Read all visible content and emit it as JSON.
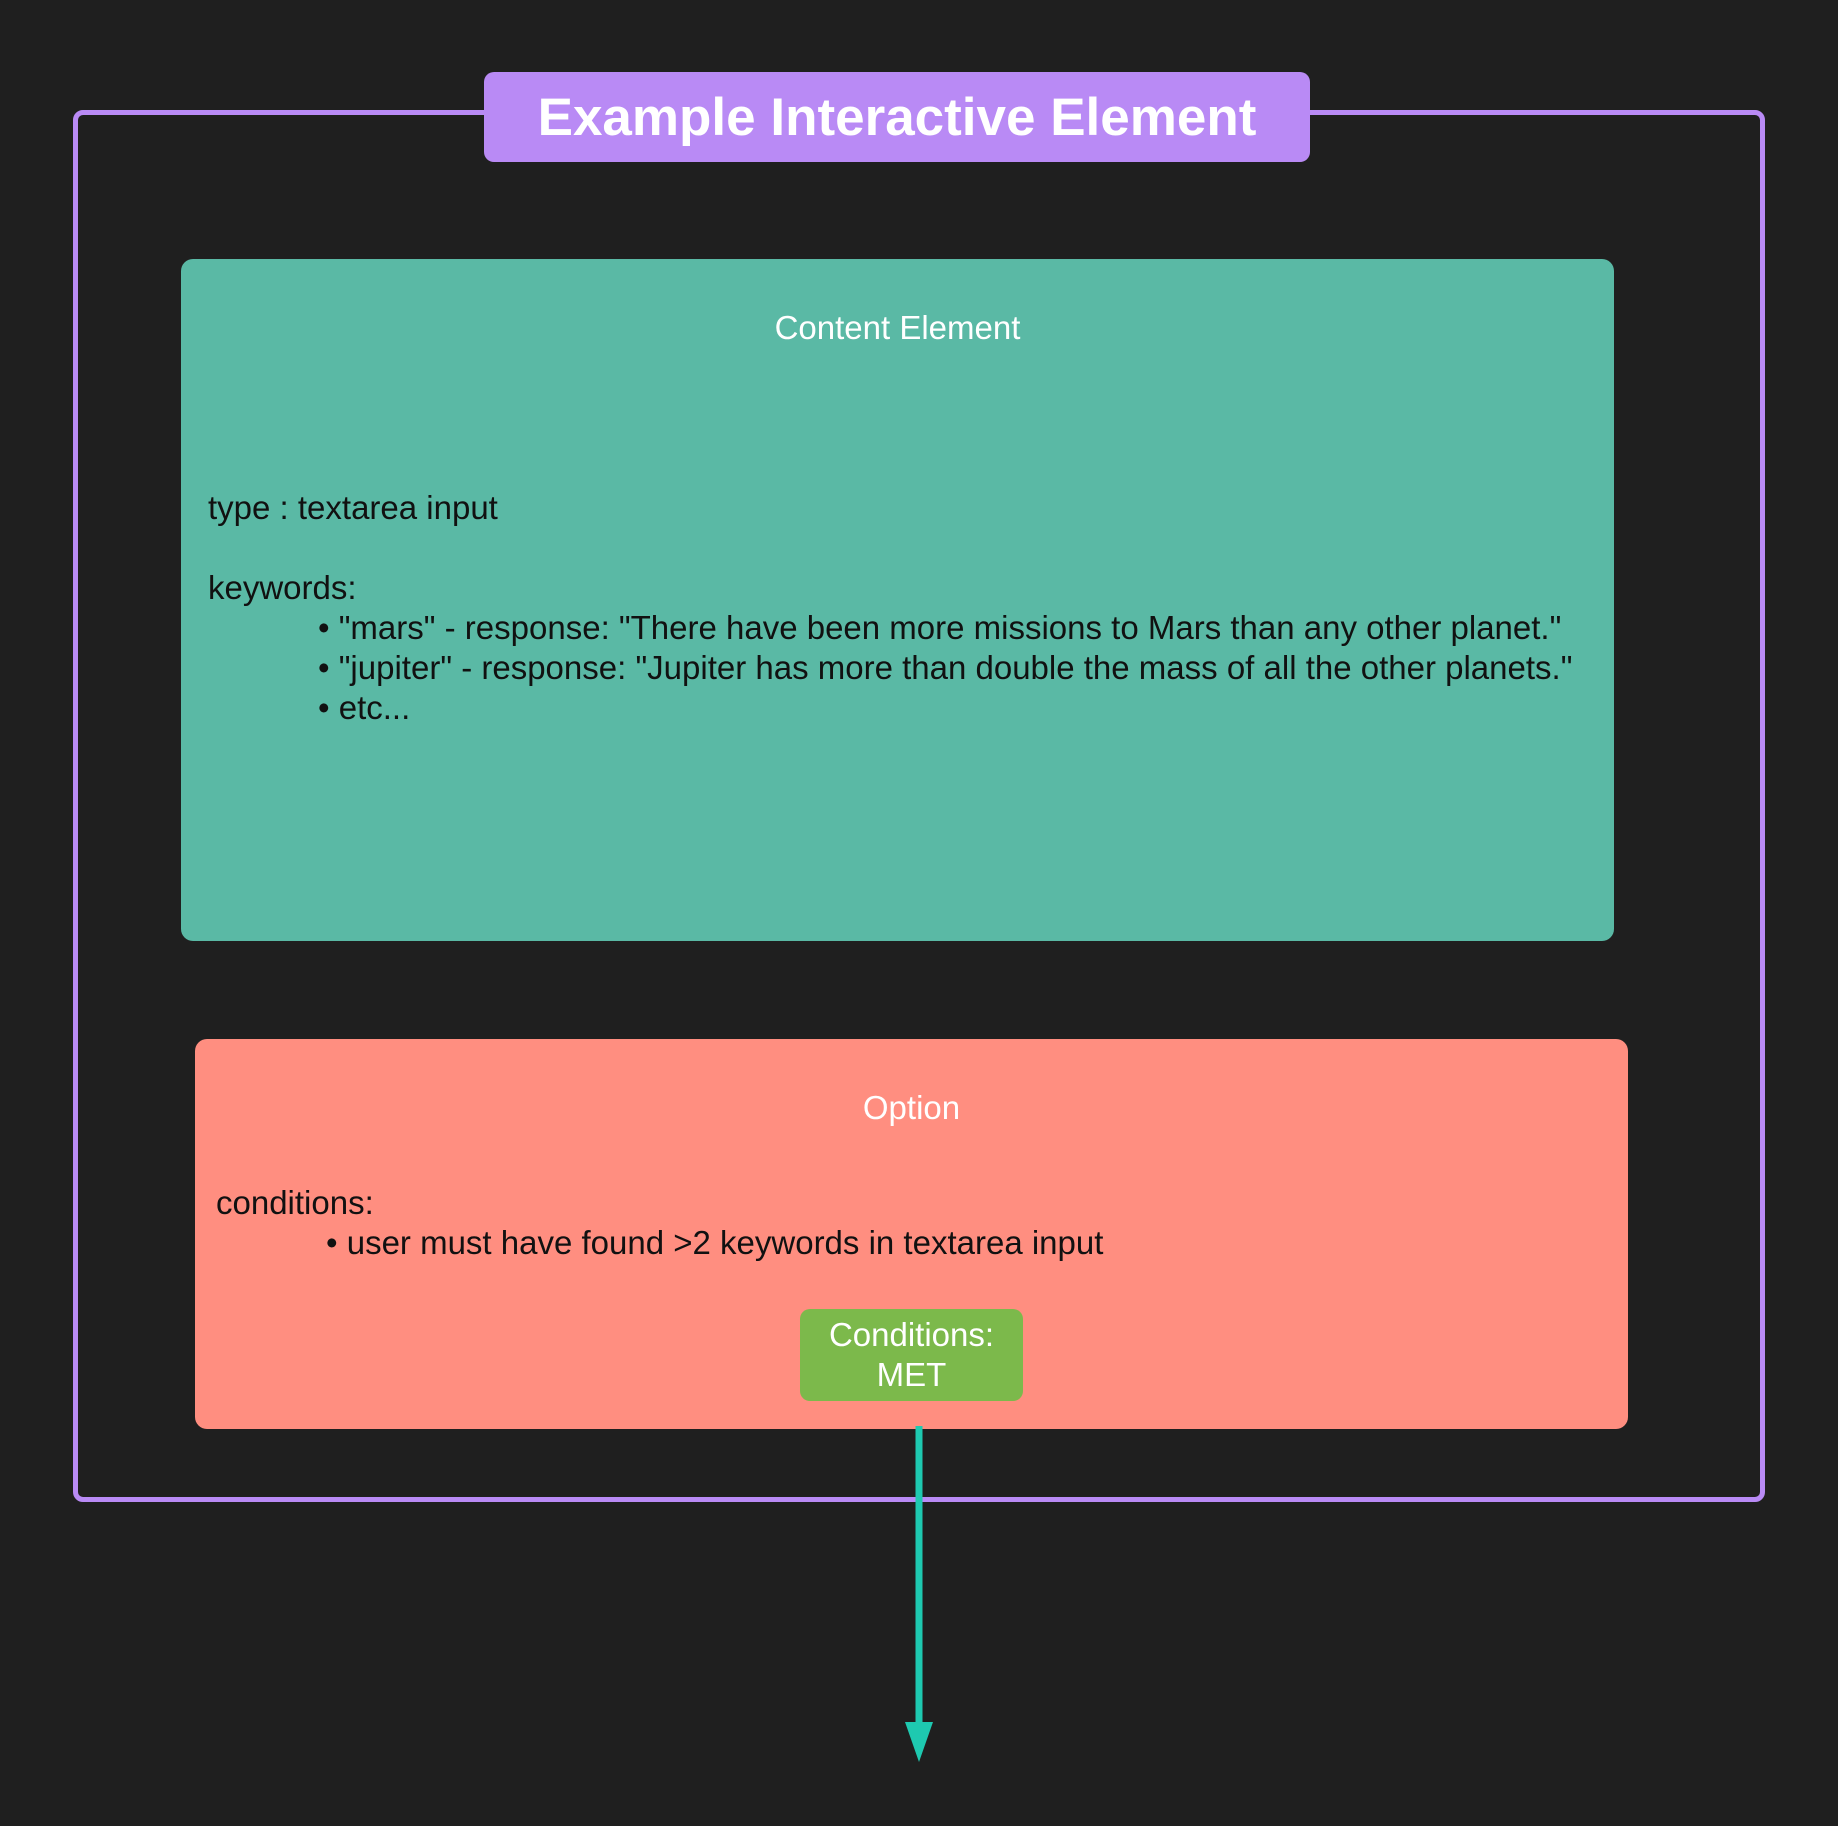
{
  "frame": {
    "title": "Example Interactive Element"
  },
  "content_element": {
    "heading": "Content Element",
    "type_line": "type : textarea input",
    "keywords_label": "keywords:",
    "keywords": [
      "• \"mars\" - response: \"There have been more missions to Mars than any other planet.\"",
      "• \"jupiter\" - response: \"Jupiter has more than double the mass of all the other planets.\"",
      "•  etc..."
    ]
  },
  "option": {
    "heading": "Option",
    "conditions_label": "conditions:",
    "conditions": [
      "• user must have found >2 keywords in textarea input"
    ],
    "status_line1": "Conditions:",
    "status_line2": "MET"
  },
  "colors": {
    "background": "#1f1f1f",
    "frame": "#b98af5",
    "content_box": "#5ab9a5",
    "option_box": "#ff8e80",
    "status_badge": "#7cb94b",
    "arrow": "#1ec9b0"
  }
}
